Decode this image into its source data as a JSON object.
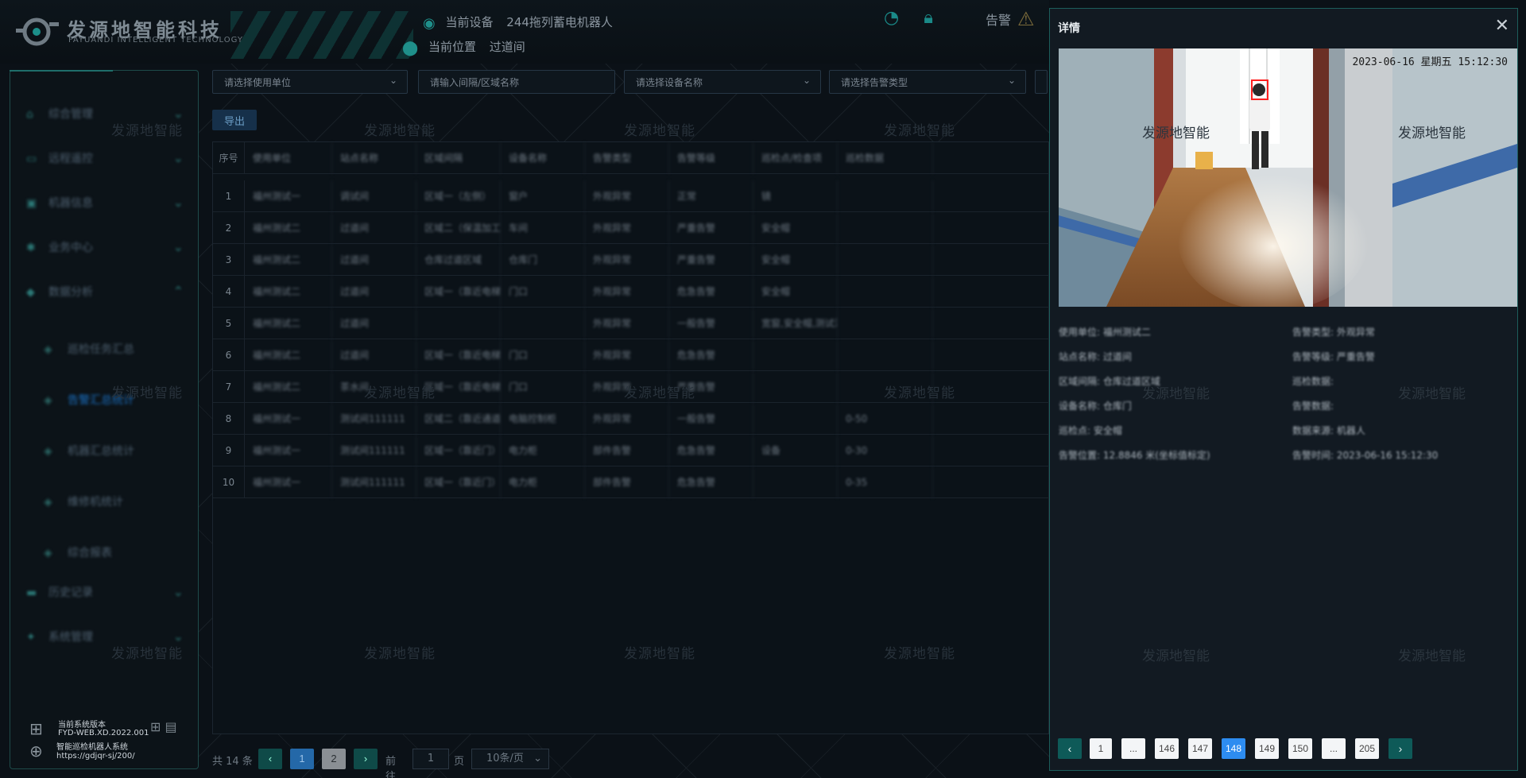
{
  "header": {
    "brand": "发源地智能科技",
    "brand_en": "FAYUANDI INTELLIGENT TECHNOLOGY",
    "current_device_label": "当前设备",
    "current_device_value": "244拖列蓄电机器人",
    "current_location_label": "当前位置",
    "current_location_value": "过道间",
    "alarm_label": "告警"
  },
  "sidebar": {
    "menu": [
      {
        "label": "综合管理",
        "icon": "home-icon"
      },
      {
        "label": "远程遥控",
        "icon": "monitor-icon"
      },
      {
        "label": "机器信息",
        "icon": "robot-icon"
      },
      {
        "label": "业务中心",
        "icon": "gear-icon"
      },
      {
        "label": "数据分析",
        "icon": "chart-icon"
      }
    ],
    "submenu": [
      {
        "label": "巡检任务汇总"
      },
      {
        "label": "告警汇总统计",
        "active": true
      },
      {
        "label": "机器汇总统计"
      },
      {
        "label": "维修机统计"
      },
      {
        "label": "综合报表"
      }
    ],
    "menu_bottom": [
      {
        "label": "历史记录",
        "icon": "folder-icon"
      },
      {
        "label": "系统管理",
        "icon": "settings-icon"
      }
    ],
    "version": {
      "label": "当前系统版本",
      "code": "FYD-WEB.XD.2022.001",
      "system_name": "智能巡检机器人系统",
      "url": "https://gdjqr-sj/200/"
    }
  },
  "filters": {
    "unit_placeholder": "请选择使用单位",
    "area_placeholder": "请输入间隔/区域名称",
    "device_placeholder": "请选择设备名称",
    "alarm_type_placeholder": "请选择告警类型"
  },
  "toolbar": {
    "export_label": "导出"
  },
  "table": {
    "headers": [
      "序号",
      "使用单位",
      "站点名称",
      "区域间隔",
      "设备名称",
      "告警类型",
      "告警等级",
      "巡检点/检查项",
      "巡检数据"
    ],
    "rows": [
      [
        "1",
        "福州测试一",
        "调试间",
        "区域一（左侧）",
        "窗户",
        "外观异常",
        "正常",
        "镜",
        ""
      ],
      [
        "2",
        "福州测试二",
        "过道间",
        "区域二（保温加工...",
        "车间",
        "外观异常",
        "严重告警",
        "安全帽",
        ""
      ],
      [
        "3",
        "福州测试二",
        "过道间",
        "仓库过道区域",
        "仓库门",
        "外观异常",
        "严重告警",
        "安全帽",
        ""
      ],
      [
        "4",
        "福州测试二",
        "过道间",
        "区域一（靠近电梯）",
        "门口",
        "外观异常",
        "危急告警",
        "安全帽",
        ""
      ],
      [
        "5",
        "福州测试二",
        "过道间",
        "",
        "",
        "外观异常",
        "一般告警",
        "宽窗,安全帽,测试法",
        ""
      ],
      [
        "6",
        "福州测试二",
        "过道间",
        "区域一（靠近电梯）",
        "门口",
        "外观异常",
        "危急告警",
        "",
        ""
      ],
      [
        "7",
        "福州测试二",
        "茶水间",
        "区域一（靠近电梯）",
        "门口",
        "外观异常",
        "严重告警",
        "",
        ""
      ],
      [
        "8",
        "福州测试一",
        "测试间111111",
        "区域二（靠近通道）",
        "电脑控制柜",
        "外观异常",
        "一般告警",
        "",
        "0-50"
      ],
      [
        "9",
        "福州测试一",
        "测试间111111",
        "区域一（靠近门）",
        "电力柜",
        "部件告警",
        "危急告警",
        "设备",
        "0-30"
      ],
      [
        "10",
        "福州测试一",
        "测试间111111",
        "区域一（靠近门）",
        "电力柜",
        "部件告警",
        "危急告警",
        "",
        "0-35"
      ]
    ]
  },
  "pager": {
    "total_text": "共 14 条",
    "pages": [
      "1",
      "2"
    ],
    "current": "1",
    "goto_label": "前往",
    "goto_value": "1",
    "page_unit": "页",
    "page_size": "10条/页"
  },
  "watermark": "发源地智能",
  "drawer": {
    "title": "详情",
    "timestamp": "2023-06-16 星期五 15:12:30",
    "info_left": [
      "使用单位: 福州测试二",
      "站点名称: 过道间",
      "区域间隔: 仓库过道区域",
      "设备名称: 仓库门",
      "巡检点: 安全帽",
      "告警位置: 12.8846 米(坐标值标定)"
    ],
    "info_right": [
      "告警类型: 外观异常",
      "告警等级: 严重告警",
      "巡检数据:",
      "告警数据:",
      "数据来源: 机器人",
      "告警时间: 2023-06-16 15:12:30"
    ],
    "pagination": {
      "prev": "‹",
      "next": "›",
      "items": [
        "1",
        "...",
        "146",
        "147",
        "148",
        "149",
        "150",
        "...",
        "205"
      ],
      "current": "148"
    }
  }
}
